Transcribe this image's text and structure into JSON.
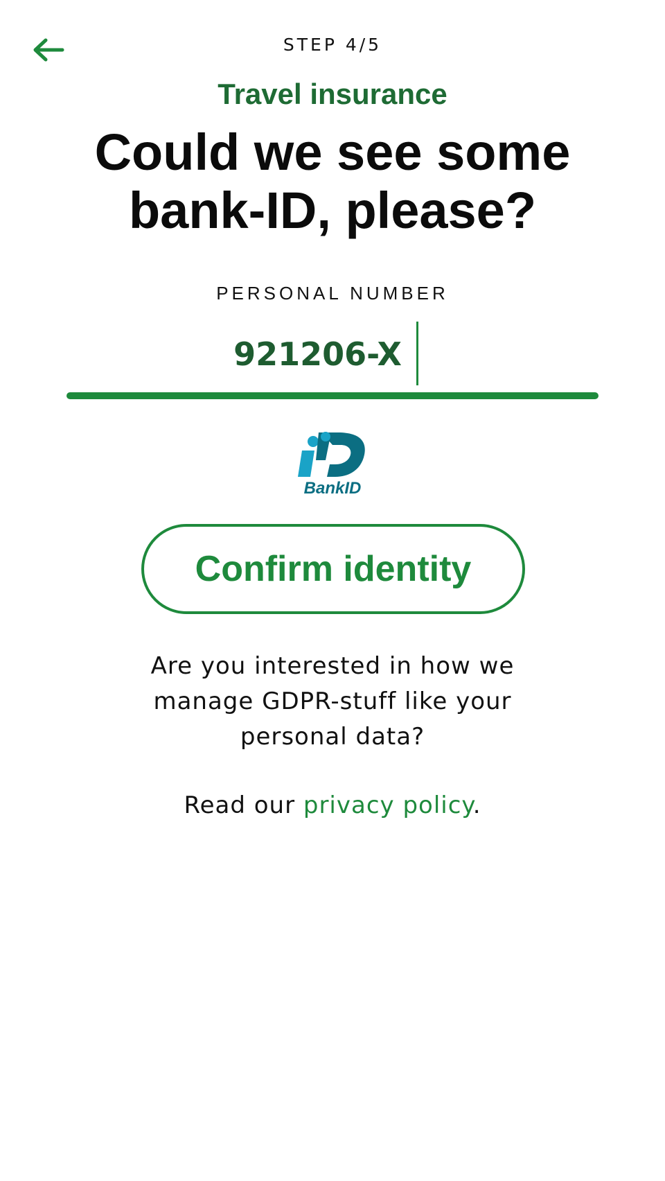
{
  "header": {
    "back_icon": "arrow-left-icon",
    "step_text": "STEP 4/5"
  },
  "subtitle": "Travel insurance",
  "headline": "Could we see some bank-ID, please?",
  "personal_number": {
    "label": "PERSONAL NUMBER",
    "value": "921206-X"
  },
  "bankid_logo": {
    "text": "BankID",
    "colors": {
      "light": "#1aa3c7",
      "dark": "#0b6e82"
    }
  },
  "confirm_button": {
    "label": "Confirm identity"
  },
  "gdpr": {
    "question": "Are you interested in how we manage GDPR-stuff like your personal data?",
    "read_prefix": "Read our ",
    "link_text": "privacy policy",
    "suffix": "."
  },
  "colors": {
    "accent": "#1e8a3c",
    "accent_dark": "#1e6b34",
    "text": "#111111",
    "background": "#ffffff"
  }
}
